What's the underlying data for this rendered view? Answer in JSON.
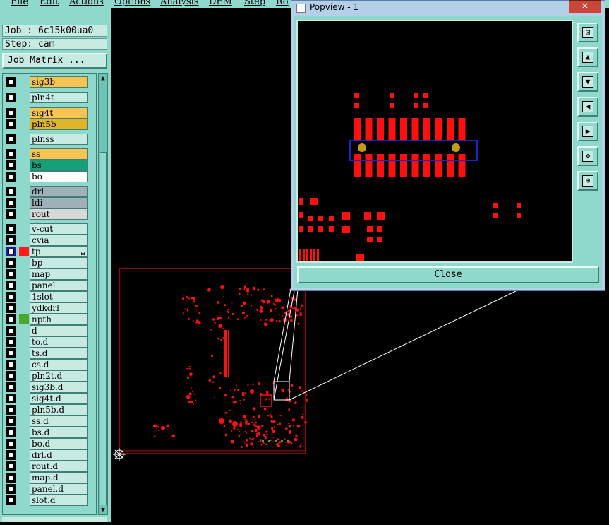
{
  "menubar": {
    "items": [
      {
        "label": "File"
      },
      {
        "label": "Edit"
      },
      {
        "label": "Actions"
      },
      {
        "label": "Options"
      },
      {
        "label": "Analysis"
      },
      {
        "label": "DFM"
      },
      {
        "label": "Step"
      },
      {
        "label": "Ro"
      }
    ]
  },
  "info": {
    "job": "Job : 6c15k00ua0",
    "step": "Step: cam",
    "job_matrix_label": "Job Matrix ..."
  },
  "layers": [
    {
      "name": "sig3b",
      "color": "#f5c452",
      "swatch": ""
    },
    {
      "name": "pln4t",
      "color": "#c7eae3",
      "swatch": ""
    },
    {
      "name": "sig4t",
      "color": "#f5c452",
      "swatch": ""
    },
    {
      "name": "pln5b",
      "color": "#e0b428",
      "swatch": ""
    },
    {
      "name": "plnss",
      "color": "#c7eae3",
      "swatch": ""
    },
    {
      "name": "ss",
      "color": "#f5c452",
      "swatch": ""
    },
    {
      "name": "bs",
      "color": "#15a07a",
      "swatch": ""
    },
    {
      "name": "bo",
      "color": "#ffffff",
      "swatch": ""
    },
    {
      "name": "drl",
      "color": "#9fb0b8",
      "swatch": ""
    },
    {
      "name": "ldi",
      "color": "#9fb0b8",
      "swatch": ""
    },
    {
      "name": "rout",
      "color": "#d8d8d8",
      "swatch": ""
    },
    {
      "name": "v-cut",
      "color": "#c7eae3",
      "swatch": ""
    },
    {
      "name": "cvia",
      "color": "#c7eae3",
      "swatch": ""
    },
    {
      "name": "tp",
      "color": "#c7eae3",
      "swatch": "#ff1a1a",
      "checked": true,
      "mark": "⊞"
    },
    {
      "name": "bp",
      "color": "#c7eae3",
      "swatch": ""
    },
    {
      "name": "map",
      "color": "#c7eae3",
      "swatch": ""
    },
    {
      "name": "panel",
      "color": "#c7eae3",
      "swatch": ""
    },
    {
      "name": "1slot",
      "color": "#c7eae3",
      "swatch": ""
    },
    {
      "name": "ydkdrl",
      "color": "#c7eae3",
      "swatch": ""
    },
    {
      "name": "npth",
      "color": "#c7eae3",
      "swatch": "#4aa82a"
    },
    {
      "name": "d",
      "color": "#c7eae3",
      "swatch": ""
    },
    {
      "name": "to.d",
      "color": "#c7eae3",
      "swatch": ""
    },
    {
      "name": "ts.d",
      "color": "#c7eae3",
      "swatch": ""
    },
    {
      "name": "cs.d",
      "color": "#c7eae3",
      "swatch": ""
    },
    {
      "name": "pln2t.d",
      "color": "#c7eae3",
      "swatch": ""
    },
    {
      "name": "sig3b.d",
      "color": "#c7eae3",
      "swatch": ""
    },
    {
      "name": "sig4t.d",
      "color": "#c7eae3",
      "swatch": ""
    },
    {
      "name": "pln5b.d",
      "color": "#c7eae3",
      "swatch": ""
    },
    {
      "name": "ss.d",
      "color": "#c7eae3",
      "swatch": ""
    },
    {
      "name": "bs.d",
      "color": "#c7eae3",
      "swatch": ""
    },
    {
      "name": "bo.d",
      "color": "#c7eae3",
      "swatch": ""
    },
    {
      "name": "drl.d",
      "color": "#c7eae3",
      "swatch": ""
    },
    {
      "name": "rout.d",
      "color": "#c7eae3",
      "swatch": ""
    },
    {
      "name": "map.d",
      "color": "#c7eae3",
      "swatch": ""
    },
    {
      "name": "panel.d",
      "color": "#c7eae3",
      "swatch": ""
    },
    {
      "name": "slot.d",
      "color": "#c7eae3",
      "swatch": ""
    }
  ],
  "popup": {
    "title": "Popview - 1",
    "close_glyph": "✕",
    "close_button": "Close",
    "tools": [
      {
        "icon": "zoom-home-icon",
        "glyph": "⊡"
      },
      {
        "icon": "pan-up-icon",
        "glyph": "▲"
      },
      {
        "icon": "pan-down-icon",
        "glyph": "▼"
      },
      {
        "icon": "pan-left-icon",
        "glyph": "◀"
      },
      {
        "icon": "pan-right-icon",
        "glyph": "▶"
      },
      {
        "icon": "zoom-fit-icon",
        "glyph": "✥"
      },
      {
        "icon": "zoom-center-icon",
        "glyph": "⊕"
      }
    ]
  },
  "colors": {
    "panel_bg": "#8fd9cc",
    "pad_red": "#ff1010",
    "board_outline": "#ff2020",
    "selection_blue": "#1e24c8",
    "drill_gold": "#c49a1e"
  }
}
